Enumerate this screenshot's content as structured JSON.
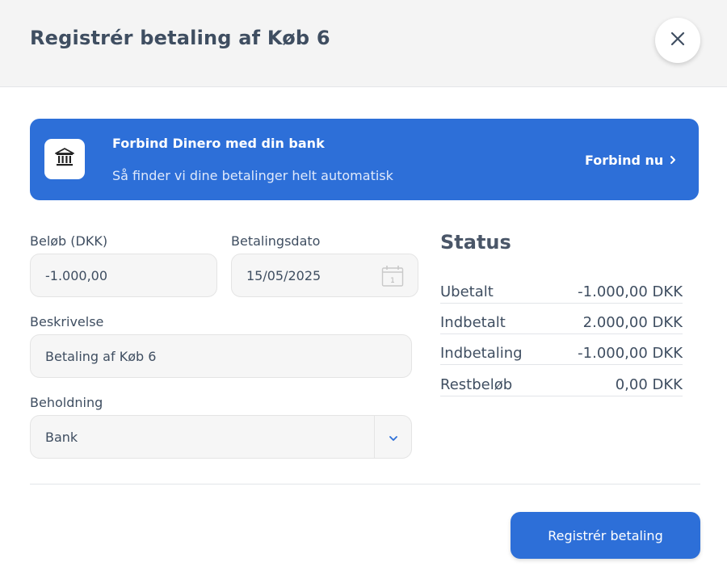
{
  "dialog": {
    "title": "Registrér betaling af Køb 6"
  },
  "banner": {
    "title": "Forbind Dinero med din bank",
    "subtitle": "Så finder vi dine betalinger helt automatisk",
    "cta": "Forbind nu"
  },
  "form": {
    "amount_label": "Beløb (DKK)",
    "amount_value": "-1.000,00",
    "date_label": "Betalingsdato",
    "date_value": "15/05/2025",
    "calendar_day": "1",
    "description_label": "Beskrivelse",
    "description_value": "Betaling af Køb 6",
    "account_label": "Beholdning",
    "account_value": "Bank"
  },
  "status": {
    "title": "Status",
    "rows": [
      {
        "label": "Ubetalt",
        "value": "-1.000,00 DKK"
      },
      {
        "label": "Indbetalt",
        "value": "2.000,00 DKK"
      },
      {
        "label": "Indbetaling",
        "value": "-1.000,00 DKK"
      },
      {
        "label": "Restbeløb",
        "value": "0,00 DKK"
      }
    ]
  },
  "footer": {
    "submit_label": "Registrér betaling"
  },
  "colors": {
    "primary": "#2d6fd8",
    "header_bg": "#f4f4f4",
    "text": "#3f4e61"
  }
}
